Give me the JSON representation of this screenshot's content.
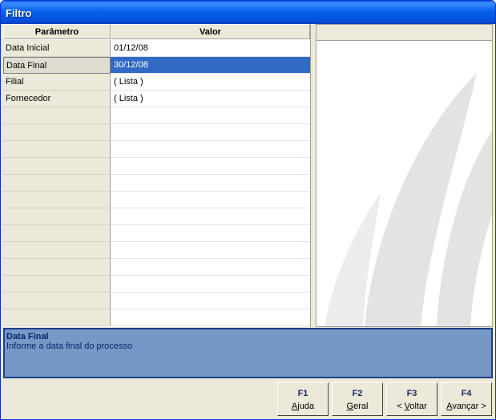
{
  "window": {
    "title": "Filtro"
  },
  "grid": {
    "headers": {
      "parametro": "Parâmetro",
      "valor": "Valor"
    },
    "rows": [
      {
        "param": "Data Inicial",
        "value": "01/12/08"
      },
      {
        "param": "Data Final",
        "value": "30/12/08",
        "selected": true
      },
      {
        "param": "Filial",
        "value": "( Lista )"
      },
      {
        "param": "Fornecedor",
        "value": "( Lista )"
      }
    ],
    "empty_rows": 13
  },
  "description": {
    "title": "Data Final",
    "text": "Informe a data final do processo"
  },
  "function_keys": [
    {
      "key": "F1",
      "pre": "",
      "u": "A",
      "post": "juda"
    },
    {
      "key": "F2",
      "pre": "",
      "u": "G",
      "post": "eral"
    },
    {
      "key": "F3",
      "pre": "< ",
      "u": "V",
      "post": "oltar"
    },
    {
      "key": "F4",
      "pre": "",
      "u": "A",
      "post": "vançar >"
    }
  ],
  "colors": {
    "selection": "#316ac5",
    "description_bg": "#7499c7",
    "titlebar": "#0450dc"
  }
}
